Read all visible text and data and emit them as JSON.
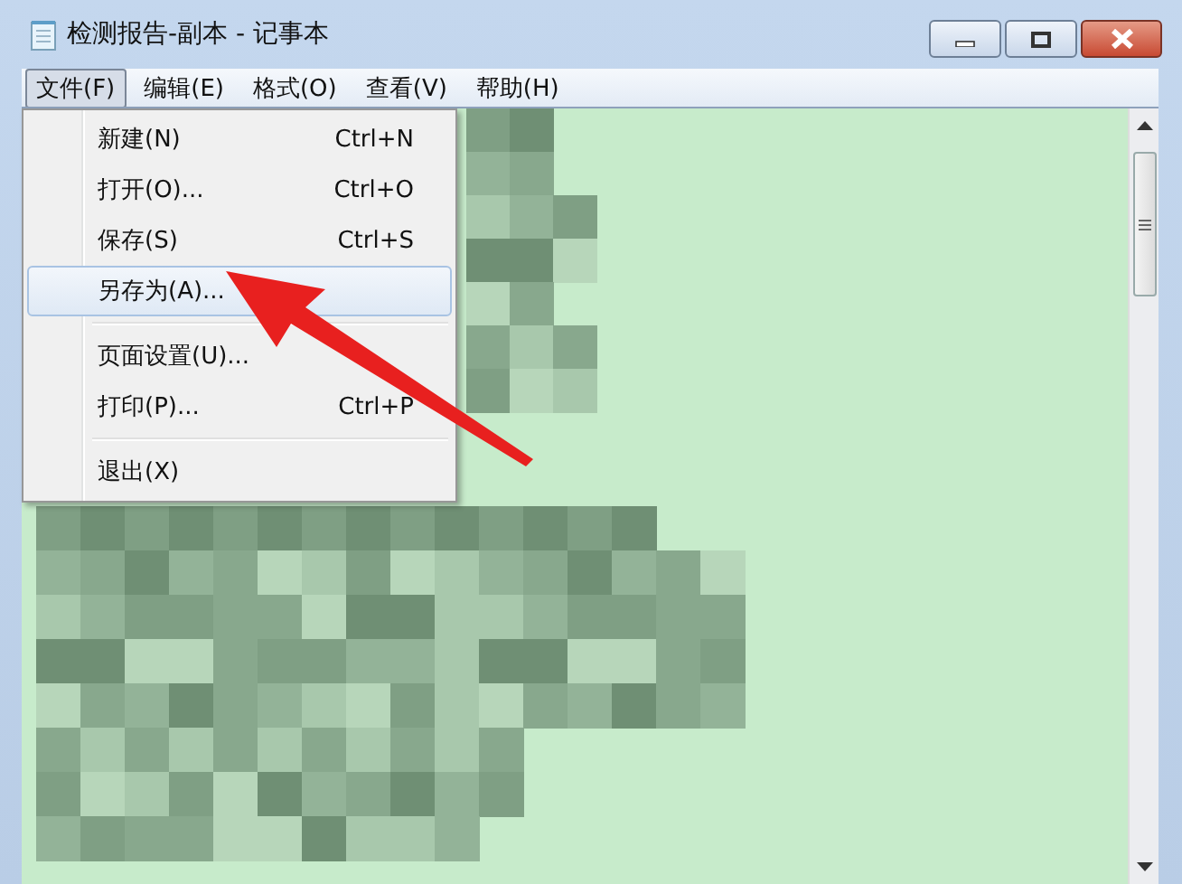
{
  "window": {
    "title": "检测报告-副本 - 记事本"
  },
  "menu_bar": [
    {
      "label": "文件(F)",
      "selected": true
    },
    {
      "label": "编辑(E)",
      "selected": false
    },
    {
      "label": "格式(O)",
      "selected": false
    },
    {
      "label": "查看(V)",
      "selected": false
    },
    {
      "label": "帮助(H)",
      "selected": false
    }
  ],
  "file_menu": [
    {
      "kind": "item",
      "label": "新建(N)",
      "shortcut": "Ctrl+N",
      "selected": false
    },
    {
      "kind": "item",
      "label": "打开(O)...",
      "shortcut": "Ctrl+O",
      "selected": false
    },
    {
      "kind": "item",
      "label": "保存(S)",
      "shortcut": "Ctrl+S",
      "selected": false
    },
    {
      "kind": "item",
      "label": "另存为(A)...",
      "selected": true
    },
    {
      "kind": "separator"
    },
    {
      "kind": "item",
      "label": "页面设置(U)...",
      "selected": false
    },
    {
      "kind": "item",
      "label": "打印(P)...",
      "shortcut": "Ctrl+P",
      "selected": false
    },
    {
      "kind": "separator"
    },
    {
      "kind": "item",
      "label": "退出(X)",
      "selected": false
    }
  ]
}
